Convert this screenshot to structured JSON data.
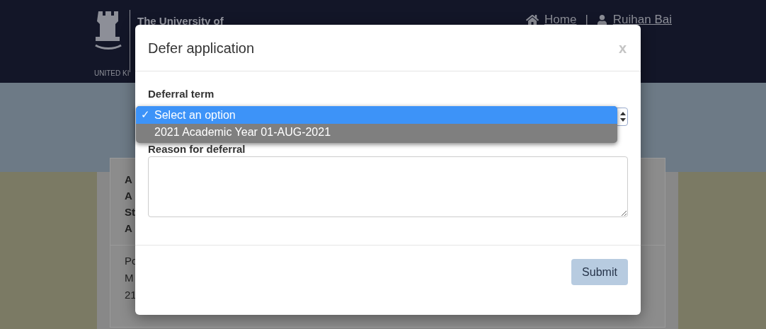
{
  "header": {
    "logo_text": "The University of",
    "logo_subtext": "UNITED KI",
    "nav": [
      {
        "kind": "home",
        "label": "Home"
      },
      {
        "kind": "user",
        "label": "Ruihan Bai"
      }
    ],
    "separator": "|"
  },
  "background_fragments": {
    "bold_lines": [
      "A",
      "A",
      "St",
      "A"
    ],
    "lines": [
      "Po",
      "M",
      "21"
    ]
  },
  "dialog": {
    "title": "Defer application",
    "close": "x",
    "deferral_term": {
      "label": "Deferral term",
      "check_mark": "✓",
      "options": [
        {
          "label": "Select an option",
          "selected": true
        },
        {
          "label": "2021 Academic Year 01-AUG-2021",
          "selected": false
        }
      ]
    },
    "reason": {
      "label": "Reason for deferral"
    },
    "submit": "Submit"
  }
}
